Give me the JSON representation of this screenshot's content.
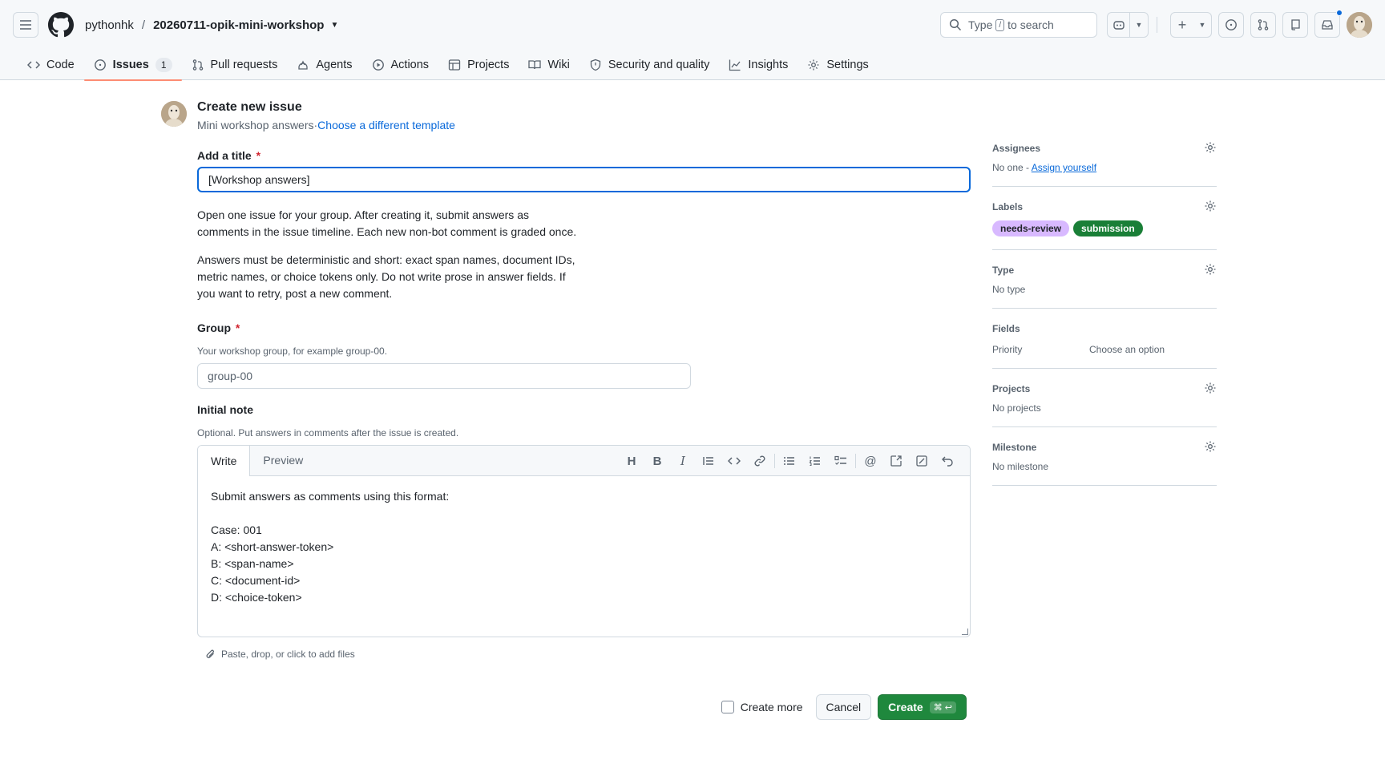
{
  "header": {
    "owner": "pythonhk",
    "separator": "/",
    "repo": "20260711-opik-mini-workshop",
    "search": {
      "prefix": "Type",
      "key": "/",
      "suffix": "to search"
    }
  },
  "nav": {
    "tabs": [
      {
        "label": "Code",
        "icon": "code-icon"
      },
      {
        "label": "Issues",
        "icon": "issue-opened-icon",
        "count": "1",
        "active": true
      },
      {
        "label": "Pull requests",
        "icon": "git-pull-request-icon"
      },
      {
        "label": "Agents",
        "icon": "agent-icon"
      },
      {
        "label": "Actions",
        "icon": "play-icon"
      },
      {
        "label": "Projects",
        "icon": "table-icon"
      },
      {
        "label": "Wiki",
        "icon": "book-icon"
      },
      {
        "label": "Security and quality",
        "icon": "shield-icon"
      },
      {
        "label": "Insights",
        "icon": "graph-icon"
      },
      {
        "label": "Settings",
        "icon": "gear-icon"
      }
    ]
  },
  "form": {
    "title": "Create new issue",
    "template_name": "Mini workshop answers",
    "template_sep": "·",
    "template_link": "Choose a different template",
    "title_label": "Add a title",
    "required_mark": "*",
    "title_value": "[Workshop answers]",
    "para1": "Open one issue for your group. After creating it, submit answers as comments in the issue timeline. Each new non-bot comment is graded once.",
    "para2": "Answers must be deterministic and short: exact span names, document IDs, metric names, or choice tokens only. Do not write prose in answer fields. If you want to retry, post a new comment.",
    "group_label": "Group",
    "group_hint": "Your workshop group, for example group-00.",
    "group_placeholder": "group-00",
    "note_label": "Initial note",
    "note_hint": "Optional. Put answers in comments after the issue is created.",
    "editor": {
      "tab_write": "Write",
      "tab_preview": "Preview",
      "body": "Submit answers as comments using this format:\n\nCase: 001\nA: <short-answer-token>\nB: <span-name>\nC: <document-id>\nD: <choice-token>"
    },
    "attach_text": "Paste, drop, or click to add files",
    "create_more": "Create more",
    "cancel": "Cancel",
    "create": "Create",
    "create_shortcut": "⌘ ↩"
  },
  "sidebar": {
    "assignees": {
      "title": "Assignees",
      "value": "No one -",
      "link": "Assign yourself"
    },
    "labels": {
      "title": "Labels",
      "items": [
        {
          "name": "needs-review",
          "bg": "#d8b9ff",
          "fg": "#1f2328"
        },
        {
          "name": "submission",
          "bg": "#1a7f37",
          "fg": "#ffffff"
        }
      ]
    },
    "type": {
      "title": "Type",
      "value": "No type"
    },
    "fields": {
      "title": "Fields",
      "key": "Priority",
      "value": "Choose an option"
    },
    "projects": {
      "title": "Projects",
      "value": "No projects"
    },
    "milestone": {
      "title": "Milestone",
      "value": "No milestone"
    }
  }
}
